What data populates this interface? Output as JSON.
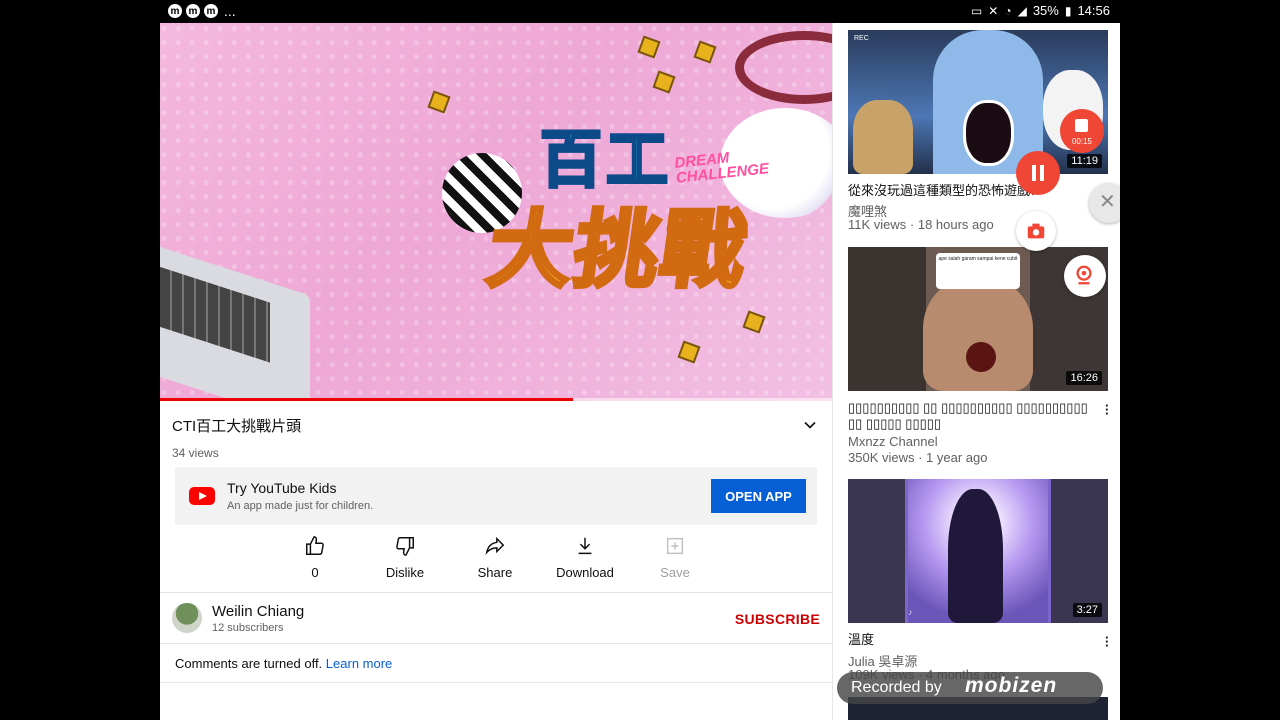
{
  "status_bar": {
    "left_icons": [
      "m",
      "m",
      "m"
    ],
    "ellipsis": "...",
    "battery": "35%",
    "time": "14:56"
  },
  "player": {
    "logo_top": "百工",
    "logo_bottom": "大挑戰",
    "logo_subtitle_1": "DREAM",
    "logo_subtitle_2": "CHALLENGE",
    "progress": 0.615
  },
  "video": {
    "title": "CTI百工大挑戰片頭",
    "views": "34 views"
  },
  "kids_promo": {
    "title": "Try YouTube Kids",
    "subtitle": "An app made just for children.",
    "button": "OPEN APP"
  },
  "actions": {
    "like": "0",
    "dislike": "Dislike",
    "share": "Share",
    "download": "Download",
    "save": "Save"
  },
  "channel": {
    "name": "Weilin Chiang",
    "subscribers": "12 subscribers",
    "subscribe": "SUBSCRIBE"
  },
  "comments": {
    "text": "Comments are turned off.",
    "link": "Learn more"
  },
  "recommendations": [
    {
      "title": "從來沒玩過這種類型的恐怖遊戲？",
      "channel": "魔哩煞",
      "meta": "11K views · 18 hours ago",
      "duration": "11:19",
      "rec_label": "REC"
    },
    {
      "title": "▯▯▯▯▯▯▯▯▯▯ ▯▯ ▯▯▯▯▯▯▯▯▯▯ ▯▯▯▯▯▯▯▯▯▯ ▯▯ ▯▯▯▯▯ ▯▯▯▯▯",
      "channel": "Mxnzz Channel",
      "meta": "350K views · 1 year ago",
      "duration": "16:26",
      "bubble_text": "ape salah garam sampai kene cubit"
    },
    {
      "title": "溫度",
      "channel": "Julia 吳卓源",
      "meta": "109K views · 4 months ago",
      "duration": "3:27"
    }
  ],
  "recorder": {
    "timer": "00:15",
    "watermark_text": "Recorded by",
    "watermark_brand": "mobizen"
  }
}
